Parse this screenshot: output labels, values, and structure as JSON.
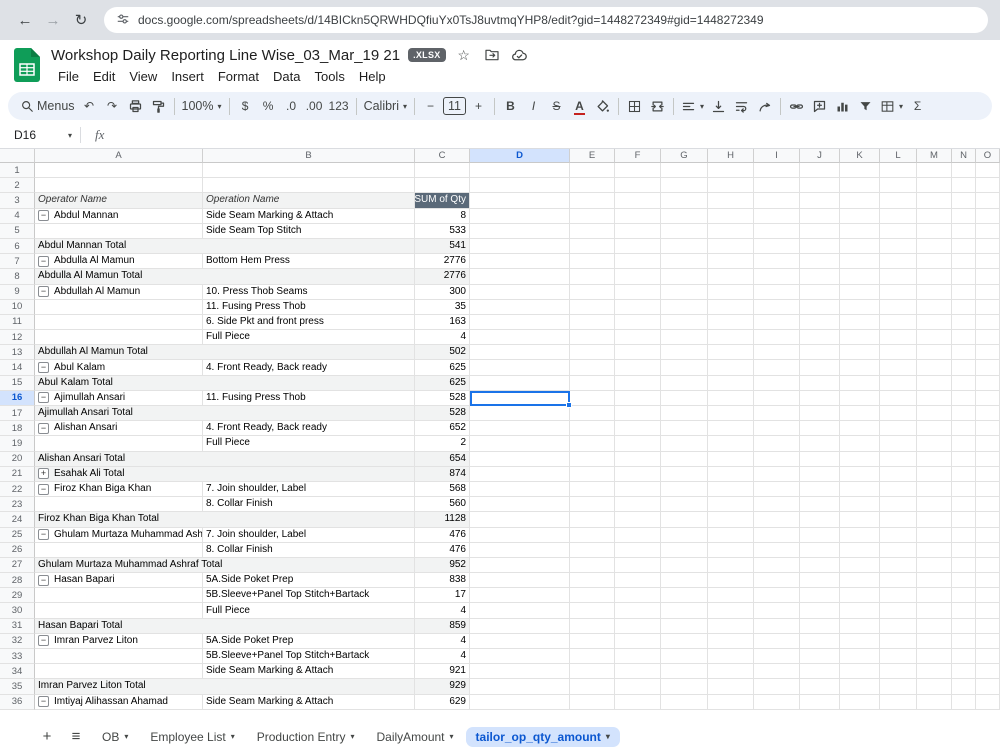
{
  "browser": {
    "back_glyph": "←",
    "forward_glyph": "→",
    "reload_glyph": "↻",
    "url": "docs.google.com/spreadsheets/d/14BICkn5QRWHDQfiuYx0TsJ8uvtmqYHP8/edit?gid=1448272349#gid=1448272349"
  },
  "header": {
    "title": "Workshop Daily Reporting Line Wise_03_Mar_19 21",
    "badge": ".XLSX",
    "star_glyph": "☆",
    "status_icons": [
      "star",
      "folder-move",
      "cloud-saved"
    ],
    "menus": [
      "File",
      "Edit",
      "View",
      "Insert",
      "Format",
      "Data",
      "Tools",
      "Help"
    ]
  },
  "icons": {
    "caret": "▾",
    "hamburger": "≡",
    "add": "+"
  },
  "toolbar": {
    "items": [
      {
        "name": "menus-button",
        "icon": "search",
        "label": "Menus"
      },
      {
        "name": "undo-button",
        "glyph": "↶"
      },
      {
        "name": "redo-button",
        "glyph": "↷"
      },
      {
        "name": "print-button",
        "icon": "printer"
      },
      {
        "name": "paint-format-button",
        "icon": "paint"
      },
      {
        "name": "divider"
      },
      {
        "name": "zoom-select",
        "label": "100%",
        "caret": true
      },
      {
        "name": "divider"
      },
      {
        "name": "format-currency-button",
        "glyph": "$"
      },
      {
        "name": "format-percent-button",
        "glyph": "%"
      },
      {
        "name": "decrease-decimals-button",
        "glyph": ".0"
      },
      {
        "name": "increase-decimals-button",
        "glyph": ".00"
      },
      {
        "name": "more-formats-button",
        "glyph": "123"
      },
      {
        "name": "divider"
      },
      {
        "name": "font-select",
        "label": "Calibri",
        "caret": true
      },
      {
        "name": "divider"
      },
      {
        "name": "decrease-font-size-button",
        "glyph": "−"
      },
      {
        "name": "font-size-input",
        "label": "11",
        "box": true
      },
      {
        "name": "increase-font-size-button",
        "glyph": "+"
      },
      {
        "name": "divider"
      },
      {
        "name": "bold-button",
        "glyph": "B",
        "style": "gb"
      },
      {
        "name": "italic-button",
        "glyph": "I",
        "style": "gi"
      },
      {
        "name": "strikethrough-button",
        "glyph": "S",
        "style": "gs"
      },
      {
        "name": "text-color-button",
        "glyph": "A",
        "style": "gtc"
      },
      {
        "name": "fill-color-button",
        "icon": "fill"
      },
      {
        "name": "divider"
      },
      {
        "name": "borders-button",
        "icon": "borders"
      },
      {
        "name": "merge-cells-button",
        "icon": "merge"
      },
      {
        "name": "divider"
      },
      {
        "name": "horizontal-align-button",
        "icon": "alignleft",
        "caret": true
      },
      {
        "name": "vertical-align-button",
        "icon": "valign"
      },
      {
        "name": "text-wrap-button",
        "icon": "wrap"
      },
      {
        "name": "text-rotation-button",
        "icon": "rotate"
      },
      {
        "name": "divider"
      },
      {
        "name": "insert-link-button",
        "icon": "link"
      },
      {
        "name": "insert-comment-button",
        "icon": "comment"
      },
      {
        "name": "insert-chart-button",
        "icon": "chart"
      },
      {
        "name": "create-filter-button",
        "icon": "filter"
      },
      {
        "name": "table-views-button",
        "icon": "table",
        "caret": true
      },
      {
        "name": "functions-button",
        "glyph": "Σ"
      }
    ]
  },
  "formula_bar": {
    "name_box": "D16",
    "fx_label": "fx",
    "formula_value": ""
  },
  "grid": {
    "columns": [
      "A",
      "B",
      "C",
      "D",
      "E",
      "F",
      "G",
      "H",
      "I",
      "J",
      "K",
      "L",
      "M",
      "N",
      "O"
    ],
    "selection": {
      "cell": "D16",
      "column": "D",
      "row": 16
    },
    "rows": [
      {
        "n": 1
      },
      {
        "n": 2
      },
      {
        "n": 3,
        "a": "Operator Name",
        "b": "Operation Name",
        "c": "SUM of Qty",
        "type": "header"
      },
      {
        "n": 4,
        "btn": "minus",
        "a": "Abdul Mannan",
        "b": "Side Seam Marking & Attach",
        "c": "8"
      },
      {
        "n": 5,
        "b": "Side Seam Top Stitch",
        "c": "533"
      },
      {
        "n": 6,
        "a": "Abdul Mannan Total",
        "c": "541",
        "type": "total"
      },
      {
        "n": 7,
        "btn": "minus",
        "a": "Abdulla Al Mamun",
        "b": "Bottom Hem Press",
        "c": "2776"
      },
      {
        "n": 8,
        "a": "Abdulla Al Mamun Total",
        "c": "2776",
        "type": "total"
      },
      {
        "n": 9,
        "btn": "minus",
        "a": "Abdullah Al Mamun",
        "b": "10. Press Thob Seams",
        "c": "300"
      },
      {
        "n": 10,
        "b": "11. Fusing Press Thob",
        "c": "35"
      },
      {
        "n": 11,
        "b": "6. Side Pkt and front press",
        "c": "163"
      },
      {
        "n": 12,
        "b": "Full Piece",
        "c": "4"
      },
      {
        "n": 13,
        "a": "Abdullah Al Mamun Total",
        "c": "502",
        "type": "total"
      },
      {
        "n": 14,
        "btn": "minus",
        "a": "Abul Kalam",
        "b": "4. Front Ready, Back ready",
        "c": "625"
      },
      {
        "n": 15,
        "a": "Abul Kalam Total",
        "c": "625",
        "type": "total"
      },
      {
        "n": 16,
        "btn": "minus",
        "a": "Ajimullah Ansari",
        "b": "11. Fusing Press Thob",
        "c": "528"
      },
      {
        "n": 17,
        "a": "Ajimullah Ansari Total",
        "c": "528",
        "type": "total"
      },
      {
        "n": 18,
        "btn": "minus",
        "a": "Alishan Ansari",
        "b": "4. Front Ready, Back ready",
        "c": "652"
      },
      {
        "n": 19,
        "b": "Full Piece",
        "c": "2"
      },
      {
        "n": 20,
        "a": "Alishan Ansari Total",
        "c": "654",
        "type": "total"
      },
      {
        "n": 21,
        "btn": "plus",
        "a": "Esahak Ali Total",
        "c": "874",
        "type": "total"
      },
      {
        "n": 22,
        "btn": "minus",
        "a": "Firoz Khan Biga Khan",
        "b": "7. Join shoulder, Label",
        "c": "568"
      },
      {
        "n": 23,
        "b": "8. Collar Finish",
        "c": "560"
      },
      {
        "n": 24,
        "a": "Firoz Khan Biga Khan Total",
        "c": "1128",
        "type": "total"
      },
      {
        "n": 25,
        "btn": "minus",
        "a": "Ghulam Murtaza Muhammad Ashraf",
        "b": "7. Join shoulder, Label",
        "c": "476"
      },
      {
        "n": 26,
        "b": "8. Collar Finish",
        "c": "476"
      },
      {
        "n": 27,
        "a": "Ghulam Murtaza Muhammad Ashraf Total",
        "c": "952",
        "type": "total"
      },
      {
        "n": 28,
        "btn": "minus",
        "a": "Hasan Bapari",
        "b": "5A.Side Poket Prep",
        "c": "838"
      },
      {
        "n": 29,
        "b": "5B.Sleeve+Panel Top Stitch+Bartack",
        "c": "17"
      },
      {
        "n": 30,
        "b": "Full Piece",
        "c": "4"
      },
      {
        "n": 31,
        "a": "Hasan Bapari Total",
        "c": "859",
        "type": "total"
      },
      {
        "n": 32,
        "btn": "minus",
        "a": "Imran Parvez Liton",
        "b": "5A.Side Poket Prep",
        "c": "4"
      },
      {
        "n": 33,
        "b": "5B.Sleeve+Panel Top Stitch+Bartack",
        "c": "4"
      },
      {
        "n": 34,
        "b": "Side Seam Marking & Attach",
        "c": "921"
      },
      {
        "n": 35,
        "a": "Imran Parvez Liton Total",
        "c": "929",
        "type": "total"
      },
      {
        "n": 36,
        "btn": "minus",
        "a": "Imtiyaj Alihassan Ahamad",
        "b": "Side Seam Marking & Attach",
        "c": "629"
      }
    ]
  },
  "sheet_tabs": {
    "tabs": [
      {
        "label": "OB"
      },
      {
        "label": "Employee List"
      },
      {
        "label": "Production Entry"
      },
      {
        "label": "DailyAmount"
      },
      {
        "label": "tailor_op_qty_amount",
        "active": true
      }
    ]
  }
}
